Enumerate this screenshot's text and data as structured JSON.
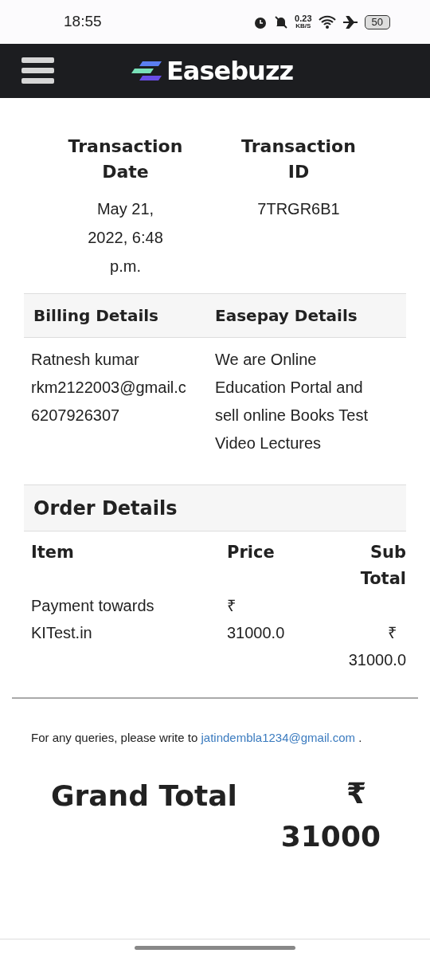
{
  "status_bar": {
    "time": "18:55",
    "net_speed": "0.23",
    "net_unit": "KB/S",
    "battery": "50"
  },
  "header": {
    "brand": "Easebuzz"
  },
  "transaction": {
    "columns": [
      "Transaction Date",
      "Transaction ID"
    ],
    "values": [
      "May 21, 2022, 6:48 p.m.",
      "7TRGR6B1"
    ]
  },
  "details": {
    "columns": [
      "Billing Details",
      "Easepay Details"
    ],
    "billing": [
      "Ratnesh kumar",
      "rkm2122003@gmail.c",
      "6207926307"
    ],
    "easepay": "We are Online Education Portal and sell online Books Test Video Lectures"
  },
  "order": {
    "title": "Order Details",
    "columns": [
      "Item",
      "Price",
      "Sub Total"
    ],
    "rows": [
      {
        "item": "Payment towards KITest.in",
        "price_currency": "₹",
        "price": "31000.0",
        "subtotal_currency": "₹",
        "subtotal": "31000.0"
      }
    ]
  },
  "queries": {
    "text": "For any queries, please write to",
    "email": "jatindembla1234@gmail.com",
    "end": "."
  },
  "grand_total": {
    "label": "Grand Total",
    "currency": "₹",
    "amount": "31000"
  }
}
